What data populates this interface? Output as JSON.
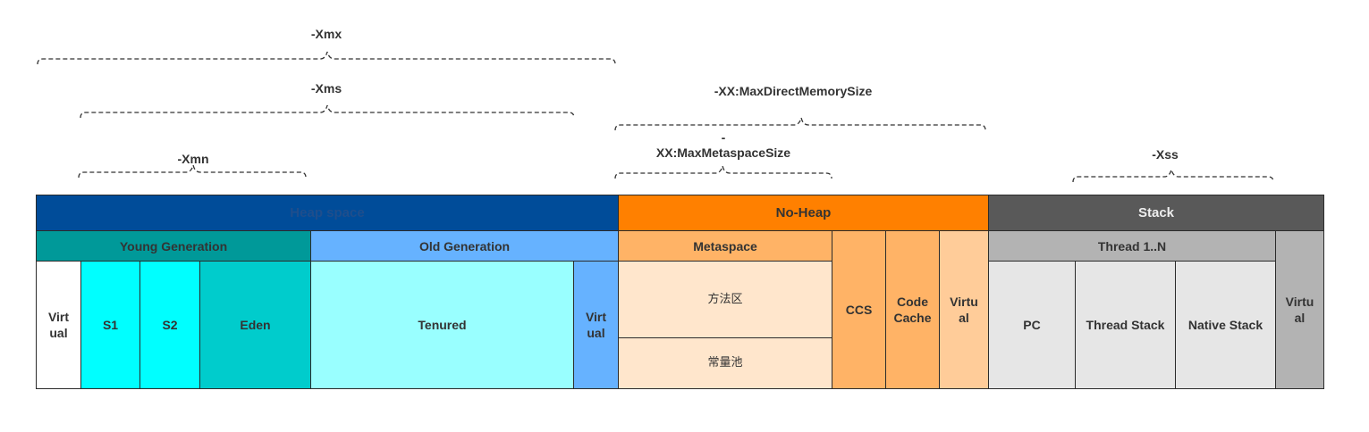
{
  "brackets": {
    "xmx": "-Xmx",
    "xms": "-Xms",
    "xmn": "-Xmn",
    "max_direct_memory": "-XX:MaxDirectMemorySize",
    "max_metaspace_dash": "-",
    "max_metaspace": "XX:MaxMetaspaceSize",
    "xss": "-Xss"
  },
  "heap": {
    "title": "Heap space",
    "young_generation": "Young Generation",
    "old_generation": "Old Generation",
    "virtual_left": "Virt\nual",
    "s1": "S1",
    "s2": "S2",
    "eden": "Eden",
    "tenured": "Tenured",
    "virtual_old": "Virt\nual"
  },
  "no_heap": {
    "title": "No-Heap",
    "metaspace": "Metaspace",
    "method_area": "方法区",
    "constant_pool": "常量池",
    "ccs": "CCS",
    "code_cache": "Code\nCache",
    "virtual": "Virtu\nal"
  },
  "stack": {
    "title": "Stack",
    "thread": "Thread  1..N",
    "pc": "PC",
    "thread_stack": "Thread Stack",
    "native_stack": "Native Stack",
    "virtual": "Virtu\nal"
  },
  "colors": {
    "heap_header": "#004c99",
    "heap_header_text": "#1f4e8c",
    "young_gen": "#009999",
    "old_gen": "#66b2ff",
    "cyan": "#00ffff",
    "eden": "#00cccc",
    "tenured": "#99ffff",
    "no_heap_header": "#ff8000",
    "metaspace": "#ffb366",
    "method_area": "#ffe6cc",
    "ccs": "#ffb366",
    "virtual_orange": "#ffcc99",
    "stack_header": "#595959",
    "thread": "#b3b3b3",
    "thread_cells": "#e6e6e6",
    "virtual_gray": "#b3b3b3"
  }
}
